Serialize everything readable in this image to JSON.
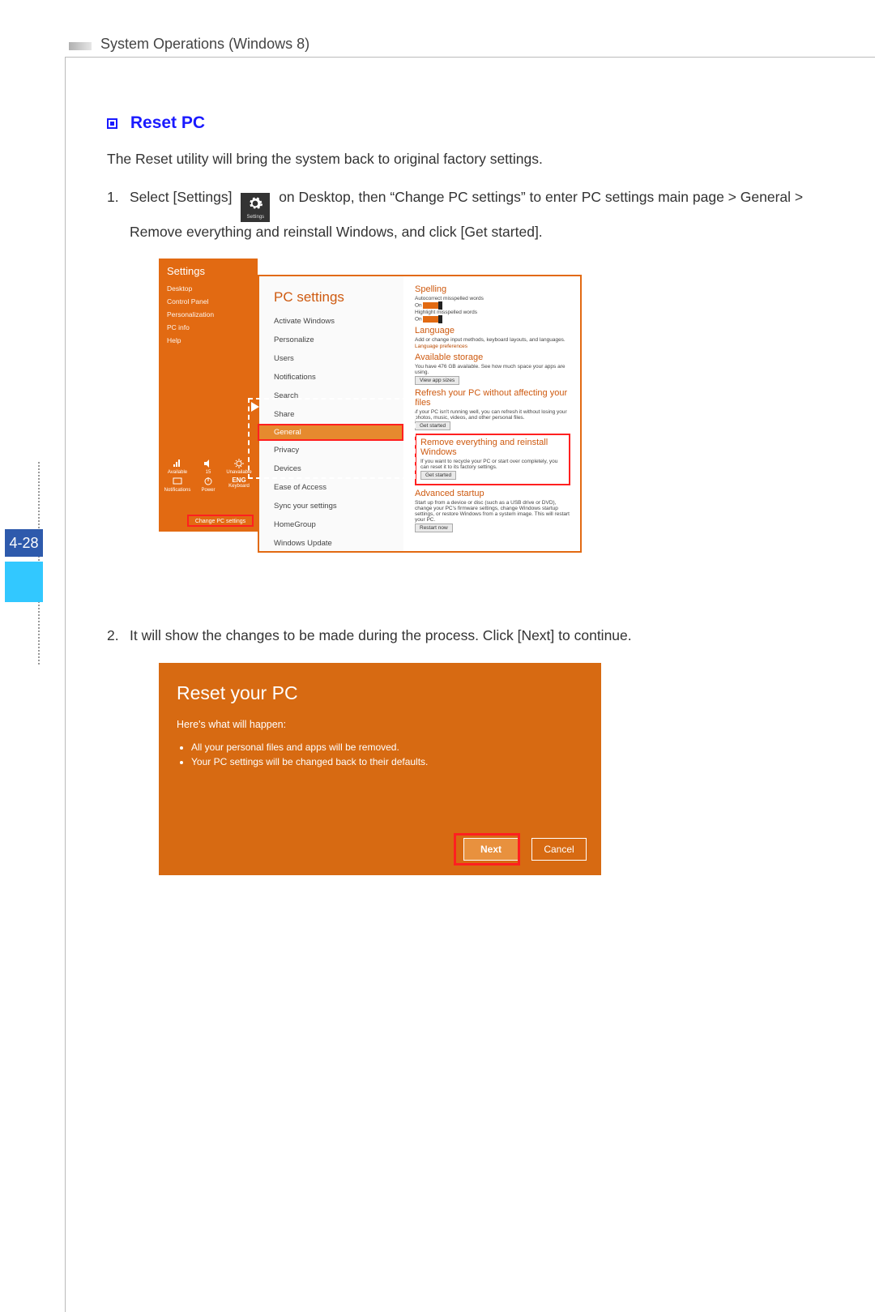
{
  "header": {
    "title": "System Operations (Windows 8)"
  },
  "page_number": "4-28",
  "section": {
    "heading": "Reset PC",
    "intro": "The Reset utility will bring the system back to original factory settings."
  },
  "steps": {
    "one": {
      "num": "1.",
      "before_icon": "Select [Settings] ",
      "icon_label": "Settings",
      "after_icon": " on Desktop, then “Change PC settings” to enter PC settings main page > General > Remove everything and reinstall Windows, and click [Get started]."
    },
    "two": {
      "num": "2.",
      "text": "It will show the changes to be made during the process. Click [Next] to continue."
    }
  },
  "shot1": {
    "sidebar_title": "Settings",
    "sidebar_items": [
      "Desktop",
      "Control Panel",
      "Personalization",
      "PC info",
      "Help"
    ],
    "bottom_icons": [
      "Available",
      "15",
      "Unavailable",
      "Notifications",
      "Power",
      "Keyboard"
    ],
    "extra_badge": "ENG",
    "change_button": "Change PC settings",
    "left_title": "PC settings",
    "left_links": [
      "Activate Windows",
      "Personalize",
      "Users",
      "Notifications",
      "Search",
      "Share",
      "General",
      "Privacy",
      "Devices",
      "Ease of Access",
      "Sync your settings",
      "HomeGroup",
      "Windows Update"
    ],
    "right": {
      "spelling_h": "Spelling",
      "spelling_a": "Autocorrect misspelled words",
      "spelling_b": "Highlight misspelled words",
      "toggle_on": "On",
      "language_h": "Language",
      "language_a": "Add or change input methods, keyboard layouts, and languages.",
      "language_link": "Language preferences",
      "storage_h": "Available storage",
      "storage_a": "You have 476 GB available. See how much space your apps are using.",
      "storage_btn": "View app sizes",
      "refresh_h": "Refresh your PC without affecting your files",
      "refresh_a": "If your PC isn't running well, you can refresh it without losing your photos, music, videos, and other personal files.",
      "refresh_btn": "Get started",
      "remove_h": "Remove everything and reinstall Windows",
      "remove_a": "If you want to recycle your PC or start over completely, you can reset it to its factory settings.",
      "remove_btn": "Get started",
      "adv_h": "Advanced startup",
      "adv_a": "Start up from a device or disc (such as a USB drive or DVD), change your PC's firmware settings, change Windows startup settings, or restore Windows from a system image. This will restart your PC.",
      "adv_btn": "Restart now"
    }
  },
  "shot2": {
    "title": "Reset your PC",
    "subtitle": "Here's what will happen:",
    "bullets": [
      "All your personal files and apps will be removed.",
      "Your PC settings will be changed back to their defaults."
    ],
    "next": "Next",
    "cancel": "Cancel"
  }
}
